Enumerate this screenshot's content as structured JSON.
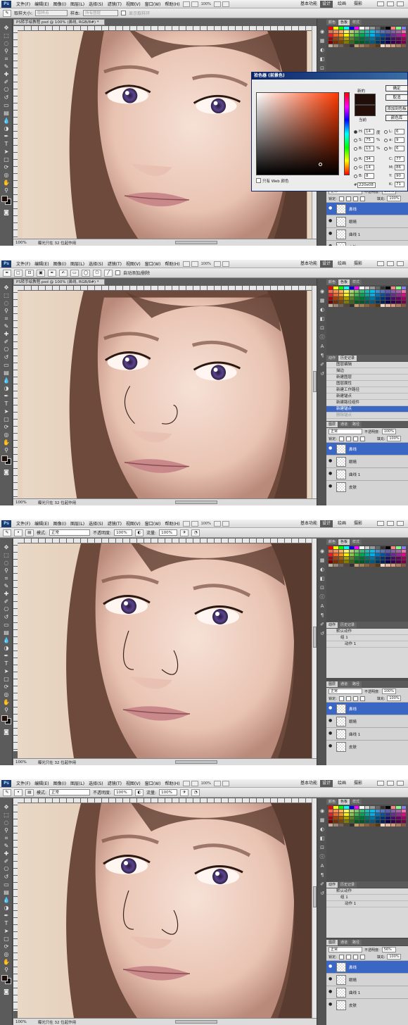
{
  "menu": {
    "items": [
      "文件(F)",
      "编辑(E)",
      "图像(I)",
      "图层(L)",
      "选择(S)",
      "滤镜(T)",
      "视图(V)",
      "窗口(W)",
      "帮助(H)"
    ],
    "zoom": "100%",
    "workspaces": {
      "basic": "基本功能",
      "design": "设计",
      "painting": "绘画",
      "photography": "摄影"
    }
  },
  "options": {
    "frame1": {
      "sample_size_label": "取样大小:",
      "sample_size_value": "取样点",
      "sample_label": "样本:",
      "sample_value": "所有图层",
      "ring_label": "显示取样环"
    },
    "frame2": {
      "auto_add_delete": "自动添加/删除"
    },
    "brush": {
      "mode_label": "模式:",
      "mode_value": "正常",
      "opacity_label": "不透明度:",
      "opacity_value": "100%",
      "flow_label": "流量:",
      "flow_value": "100%"
    }
  },
  "document": {
    "tab_frame1": "PS转手绘教程.psd @ 100% (鼻线, RGB/8#) *",
    "tab_frame2": "PS转手绘教程.psd @ 100% (鼻线, RGB/8#) *",
    "status_zoom": "100%",
    "status_text": "曝光只在 32 位起作用"
  },
  "color_picker": {
    "title": "拾色器 (前景色)",
    "new_label": "新的",
    "current_label": "当前",
    "ok": "确定",
    "cancel": "取消",
    "add_swatch": "添加到色板",
    "color_library": "颜色库",
    "web_only": "只有 Web 颜色",
    "H": "14",
    "S": "75",
    "B": "13",
    "R": "34",
    "G": "14",
    "B2": "8",
    "L": "6",
    "a": "9",
    "b": "6",
    "C": "77",
    "M": "86",
    "Y": "90",
    "K": "71",
    "hex": "220e08",
    "deg": "度",
    "pct": "%"
  },
  "panels": {
    "swatch_tabs": [
      "颜色",
      "色板",
      "样式"
    ],
    "history_tabs": [
      "动作",
      "历史记录"
    ],
    "history_items": [
      "图层编辑",
      "描边",
      "新建图层",
      "图层属性",
      "新建工作路径",
      "新建锚点",
      "新建路径组件",
      "新建锚点",
      "删除锚点"
    ],
    "action_items": [
      "默认动作",
      "组 1",
      "动作 1"
    ],
    "layer_tabs": [
      "图层",
      "通道",
      "路径"
    ],
    "blend_mode": "正常",
    "opacity_label": "不透明度:",
    "opacity_values": [
      "100%",
      "100%",
      "100%",
      "56%"
    ],
    "lock_label": "锁定:",
    "fill_label": "填充:",
    "fill_value": "100%",
    "layers": [
      "鼻线",
      "眼睛",
      "曲线 1",
      "皮肤"
    ]
  },
  "colors": {
    "foreground": "#220e08",
    "selection": "#3a66c4",
    "ui_dark": "#5f5f5f"
  }
}
